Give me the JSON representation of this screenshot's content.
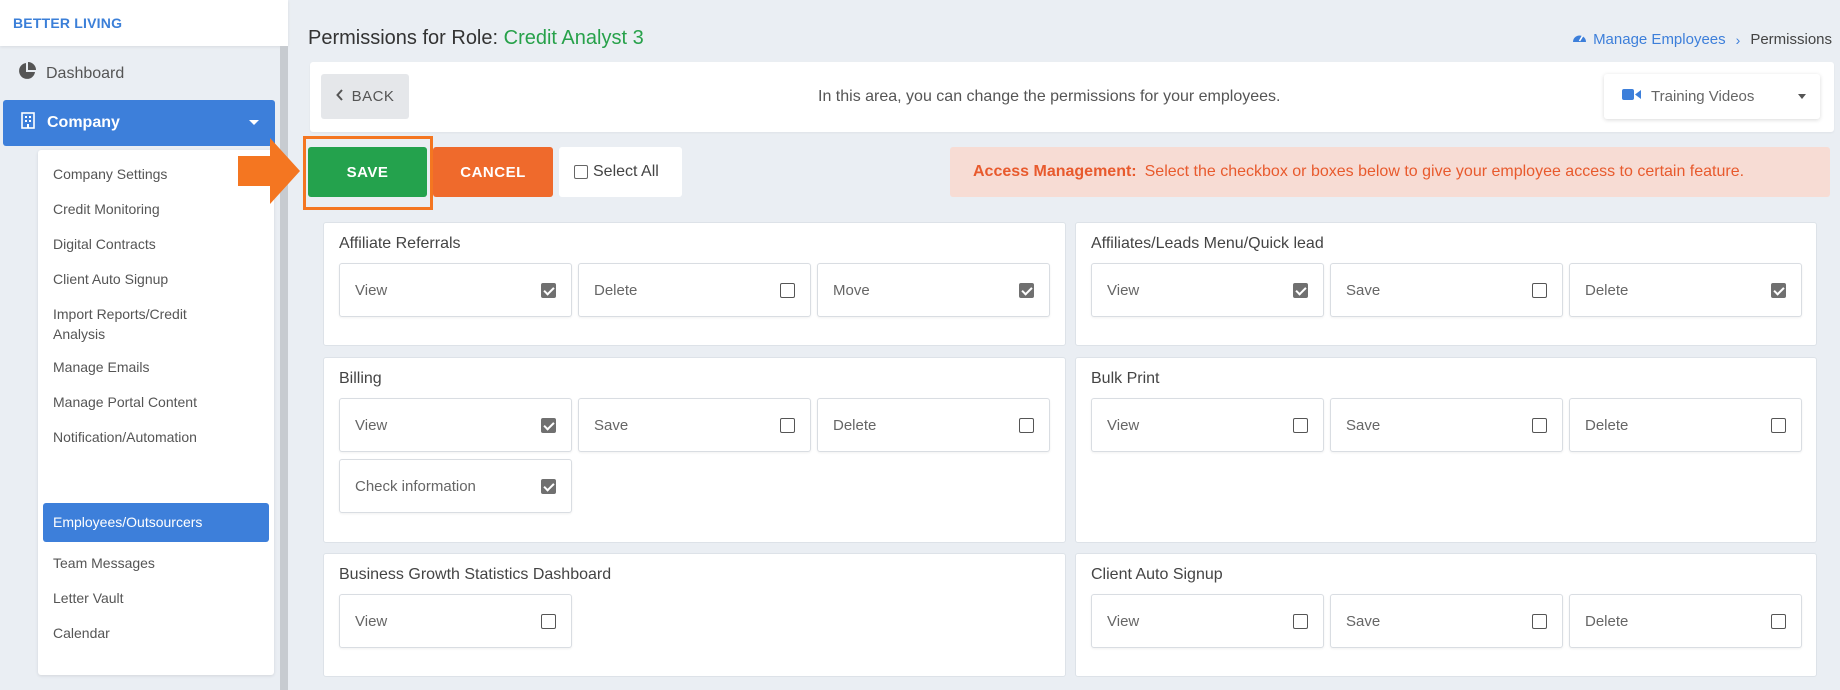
{
  "brand": "BETTER LIVING",
  "sidebar": {
    "dashboard_label": "Dashboard",
    "company_label": "Company",
    "submenu": [
      "Company Settings",
      "Credit Monitoring",
      "Digital Contracts",
      "Client Auto Signup",
      "Import Reports/Credit Analysis",
      "Manage Emails",
      "Manage Portal Content",
      "Notification/Automation",
      "Employees/Outsourcers",
      "Team Messages",
      "Letter Vault",
      "Calendar"
    ],
    "active_item": "Employees/Outsourcers"
  },
  "header": {
    "title_prefix": "Permissions for Role:",
    "role_name": "Credit Analyst 3",
    "breadcrumb_link": "Manage Employees",
    "breadcrumb_current": "Permissions"
  },
  "info_bar": {
    "back_label": "BACK",
    "text": "In this area, you can change the permissions for your employees.",
    "training_label": "Training Videos"
  },
  "actions": {
    "save_label": "SAVE",
    "cancel_label": "CANCEL",
    "select_all_label": "Select All",
    "access_title": "Access Management:",
    "access_text": "Select the checkbox or boxes below to give your employee access to certain feature."
  },
  "colors": {
    "accent_blue": "#3d7fda",
    "save_green": "#24a24d",
    "cancel_orange": "#ef6a2c",
    "highlight_orange": "#f47621",
    "role_green": "#27a14a"
  },
  "cards": [
    {
      "title": "Affiliate Referrals",
      "perms": [
        {
          "label": "View",
          "checked": true
        },
        {
          "label": "Delete",
          "checked": false
        },
        {
          "label": "Move",
          "checked": true
        }
      ]
    },
    {
      "title": "Affiliates/Leads Menu/Quick lead",
      "perms": [
        {
          "label": "View",
          "checked": true
        },
        {
          "label": "Save",
          "checked": false
        },
        {
          "label": "Delete",
          "checked": true
        }
      ]
    },
    {
      "title": "Billing",
      "perms": [
        {
          "label": "View",
          "checked": true
        },
        {
          "label": "Save",
          "checked": false
        },
        {
          "label": "Delete",
          "checked": false
        },
        {
          "label": "Check information",
          "checked": true
        }
      ]
    },
    {
      "title": "Bulk Print",
      "perms": [
        {
          "label": "View",
          "checked": false
        },
        {
          "label": "Save",
          "checked": false
        },
        {
          "label": "Delete",
          "checked": false
        }
      ]
    },
    {
      "title": "Business Growth Statistics Dashboard",
      "perms": [
        {
          "label": "View",
          "checked": false
        }
      ]
    },
    {
      "title": "Client Auto Signup",
      "perms": [
        {
          "label": "View",
          "checked": false
        },
        {
          "label": "Save",
          "checked": false
        },
        {
          "label": "Delete",
          "checked": false
        }
      ]
    }
  ]
}
